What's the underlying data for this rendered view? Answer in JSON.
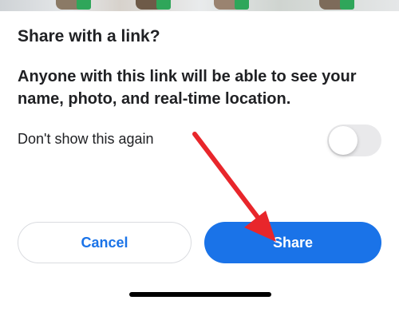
{
  "dialog": {
    "title": "Share with a link?",
    "message": "Anyone with this link will be able to see your name, photo, and real-time location.",
    "option_label": "Don't show this again",
    "option_toggle_on": false
  },
  "buttons": {
    "cancel_label": "Cancel",
    "share_label": "Share"
  },
  "colors": {
    "accent": "#1a73e8",
    "annotation_arrow": "#e8262b",
    "text": "#202124"
  },
  "icons": {
    "background_thumbnail_badge": "whatsapp-icon"
  }
}
